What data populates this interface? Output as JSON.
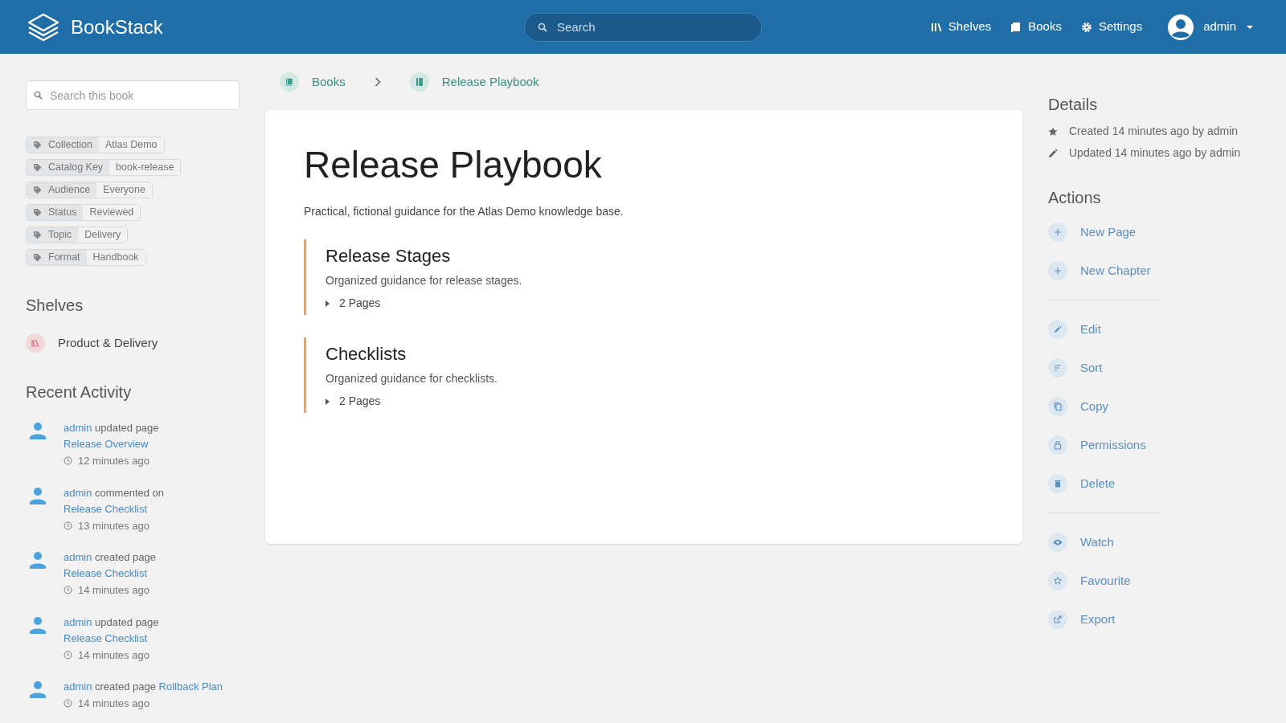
{
  "header": {
    "app_name": "BookStack",
    "search": {
      "placeholder": "Search"
    },
    "nav": [
      "Shelves",
      "Books",
      "Settings"
    ],
    "user": "admin"
  },
  "sidebar": {
    "search": {
      "placeholder": "Search this book"
    },
    "tags": [
      {
        "name": "Collection",
        "value": "Atlas Demo"
      },
      {
        "name": "Catalog Key",
        "value": "book-release"
      },
      {
        "name": "Audience",
        "value": "Everyone"
      },
      {
        "name": "Status",
        "value": "Reviewed"
      },
      {
        "name": "Topic",
        "value": "Delivery"
      },
      {
        "name": "Format",
        "value": "Handbook"
      }
    ],
    "shelves": {
      "title": "Shelves",
      "items": [
        "Product & Delivery"
      ]
    },
    "recent_activity": {
      "title": "Recent Activity",
      "items": [
        {
          "user": "admin",
          "action": "updated page",
          "target": "Release Overview",
          "time": "12 minutes ago"
        },
        {
          "user": "admin",
          "action": "commented on",
          "target": "Release Checklist",
          "time": "13 minutes ago"
        },
        {
          "user": "admin",
          "action": "created page",
          "target": "Release Checklist",
          "time": "14 minutes ago"
        },
        {
          "user": "admin",
          "action": "updated page",
          "target": "Release Checklist",
          "time": "14 minutes ago"
        },
        {
          "user": "admin",
          "action": "created page",
          "target": "Rollback Plan",
          "time": "14 minutes ago"
        }
      ]
    }
  },
  "breadcrumbs": [
    "Books",
    "Release Playbook"
  ],
  "book": {
    "title": "Release Playbook",
    "description": "Practical, fictional guidance for the Atlas Demo knowledge base.",
    "chapters": [
      {
        "title": "Release Stages",
        "description": "Organized guidance for release stages.",
        "pages": "2 Pages"
      },
      {
        "title": "Checklists",
        "description": "Organized guidance for checklists.",
        "pages": "2 Pages"
      }
    ]
  },
  "details": {
    "title": "Details",
    "items": [
      "Created 14 minutes ago by admin",
      "Updated 14 minutes ago by admin"
    ]
  },
  "actions": {
    "title": "Actions",
    "groups": [
      [
        "New Page",
        "New Chapter"
      ],
      [
        "Edit",
        "Sort",
        "Copy",
        "Permissions",
        "Delete"
      ],
      [
        "Watch",
        "Favourite",
        "Export"
      ]
    ]
  }
}
